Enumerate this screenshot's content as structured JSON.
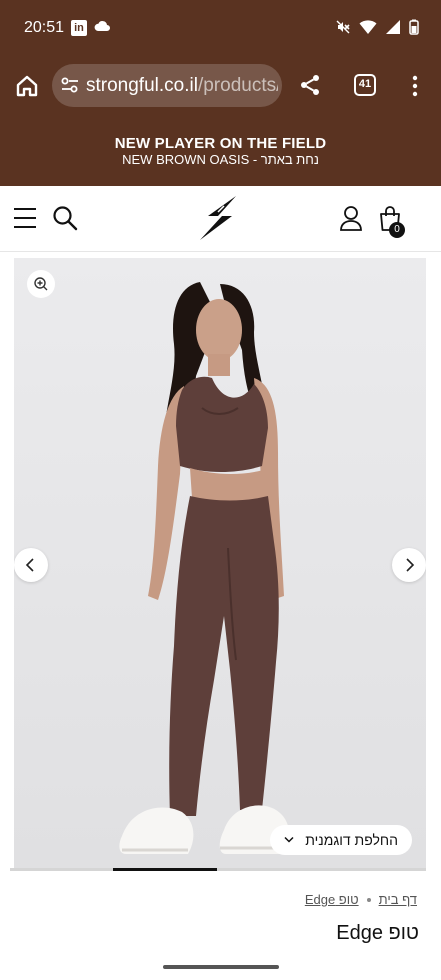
{
  "status_bar": {
    "time": "20:51",
    "icons": [
      "linkedin-icon",
      "cloud-icon",
      "mute-icon",
      "wifi-icon",
      "signal-icon",
      "battery-icon"
    ]
  },
  "browser": {
    "url_host": "strongful.co.il",
    "url_path": "/products/",
    "tab_count": "41"
  },
  "banner": {
    "line1": "NEW PLAYER ON THE FIELD",
    "line2": "NEW BROWN OASIS - נחת באתר"
  },
  "header": {
    "cart_count": "0"
  },
  "gallery": {
    "variant_switch_label": "החלפת דוגמנית"
  },
  "breadcrumb": {
    "home": "דף בית",
    "current": "טופ Edge"
  },
  "product": {
    "title": "טופ Edge"
  },
  "colors": {
    "brand_brown": "#5a3321",
    "outfit_brown": "#5e3f3a",
    "background": "#ffffff"
  }
}
